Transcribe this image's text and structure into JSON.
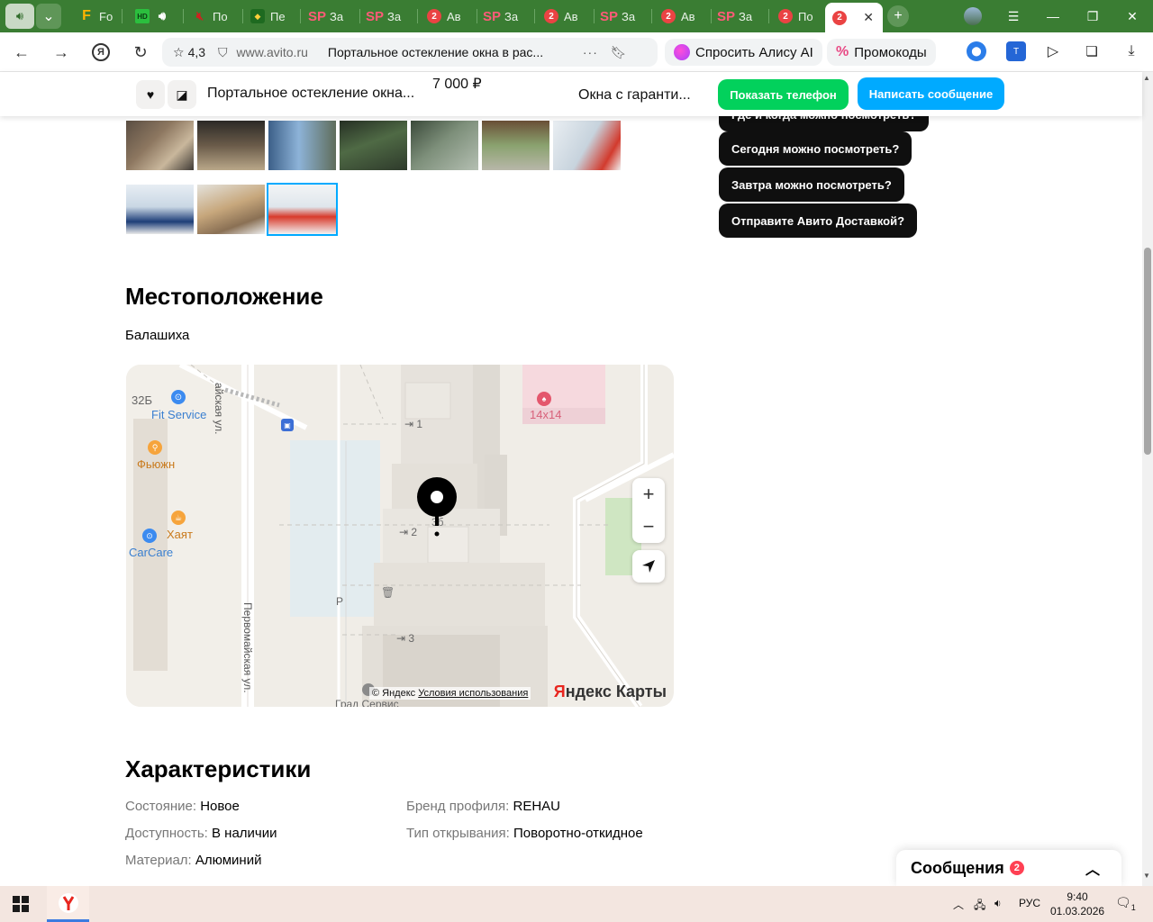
{
  "browser": {
    "tabs": [
      {
        "label": "",
        "icon": "volume-icon"
      },
      {
        "label": "Fo",
        "icon": "f-letter-icon"
      },
      {
        "label": "",
        "icon": "hd-video-icon"
      },
      {
        "label": "По",
        "icon": "mute-icon"
      },
      {
        "label": "Пе",
        "icon": "game-icon"
      },
      {
        "label": "За",
        "icon": "sp-icon"
      },
      {
        "label": "За",
        "icon": "sp-icon"
      },
      {
        "label": "Ав",
        "icon": "badge-icon",
        "badge": "2"
      },
      {
        "label": "За",
        "icon": "sp-icon"
      },
      {
        "label": "Ав",
        "icon": "badge-icon",
        "badge": "2"
      },
      {
        "label": "За",
        "icon": "sp-icon"
      },
      {
        "label": "Ав",
        "icon": "badge-icon",
        "badge": "2"
      },
      {
        "label": "За",
        "icon": "sp-icon"
      },
      {
        "label": "По",
        "icon": "badge-icon",
        "badge": "2"
      },
      {
        "label": "",
        "icon": "badge-icon",
        "badge": "2",
        "active": true
      }
    ],
    "tab_strip_color": "#3a7d33",
    "rating": "4,3",
    "domain": "www.avito.ru",
    "page_title": "Портальное остекление окна в рас...",
    "alice_label": "Спросить Алису AI",
    "promo_label": "Промокоды"
  },
  "sticky": {
    "title": "Портальное остекление окна...",
    "price": "7 000 ₽",
    "seller": "Окна с гаранти...",
    "phone_button": "Показать телефон",
    "message_button": "Написать сообщение",
    "phone_color": "#02d15c",
    "message_color": "#00aaff"
  },
  "quick_questions": [
    "Где и когда можно посмотреть?",
    "Сегодня можно посмотреть?",
    "Завтра можно посмотреть?",
    "Отправите Авито Доставкой?"
  ],
  "location": {
    "heading": "Местоположение",
    "city": "Балашиха",
    "map": {
      "labels": {
        "street_top": "айская ул.",
        "street_side": "Первомайская ул.",
        "building_32b": "32Б",
        "fit_service": "Fit Service",
        "fusion": "Фьюжн",
        "khayat": "Хаят",
        "carcare": "CarCare",
        "shop_14x14": "14х14",
        "entrance_1": "1",
        "entrance_2": "2",
        "entrance_3": "3",
        "house_number": "3б",
        "parking": "P",
        "grad_service": "Град Сервис"
      },
      "copyright": "© Яндекс",
      "terms": "Условия использования",
      "logo_first": "Я",
      "logo_rest": "ндекс Карты"
    }
  },
  "characteristics": {
    "heading": "Характеристики",
    "items": [
      {
        "key": "Состояние:",
        "value": "Новое"
      },
      {
        "key": "Доступность:",
        "value": "В наличии"
      },
      {
        "key": "Материал:",
        "value": "Алюминий"
      },
      {
        "key": "Бренд профиля:",
        "value": "REHAU"
      },
      {
        "key": "Тип открывания:",
        "value": "Поворотно-откидное"
      }
    ]
  },
  "messenger": {
    "label": "Сообщения",
    "count": "2"
  },
  "taskbar": {
    "language": "РУС",
    "time": "9:40",
    "date": "01.03.2026",
    "notifications": "1"
  }
}
